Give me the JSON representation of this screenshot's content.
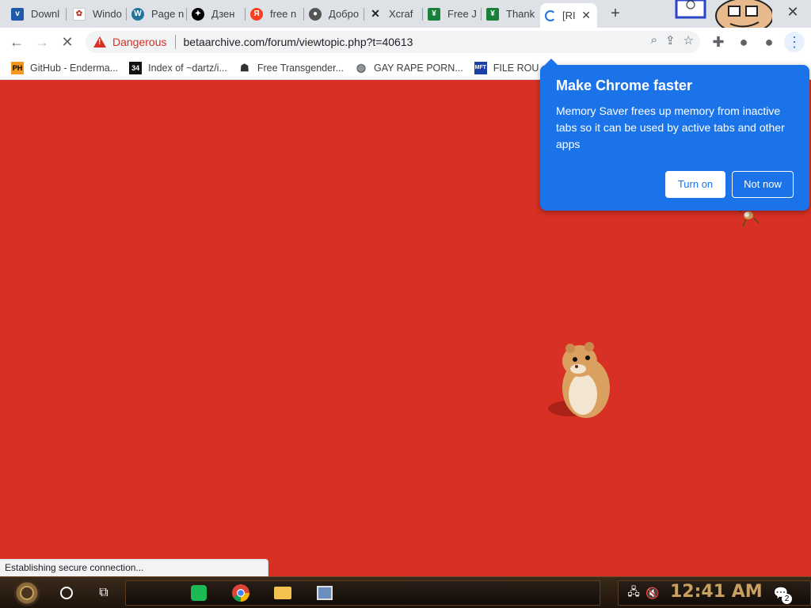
{
  "tabs": [
    {
      "label": "Downl",
      "favicon": "vimm-icon",
      "color": "#1e5aa8"
    },
    {
      "label": "Windo",
      "favicon": "windows-icon",
      "color": "#c0392b"
    },
    {
      "label": "Page n",
      "favicon": "wordpress-icon",
      "color": "#21759b"
    },
    {
      "label": "Дзен",
      "favicon": "dzen-icon",
      "color": "#000000"
    },
    {
      "label": "free n",
      "favicon": "yandex-icon",
      "color": "#fc3f1d"
    },
    {
      "label": "Добро",
      "favicon": "site-icon",
      "color": "#555555"
    },
    {
      "label": "Xcraf",
      "favicon": "xcraft-icon",
      "color": "#222222"
    },
    {
      "label": "Free J",
      "favicon": "sheet-icon",
      "color": "#188038"
    },
    {
      "label": "Thank",
      "favicon": "sheet-icon",
      "color": "#188038"
    },
    {
      "label": "[RI",
      "favicon": "loading-spinner",
      "active": true
    }
  ],
  "toolbar": {
    "security_label": "Dangerous",
    "url": "betaarchive.com/forum/viewtopic.php?t=40613"
  },
  "bookmarks": [
    {
      "label": "GitHub - Enderma...",
      "icon": "PH"
    },
    {
      "label": "Index of ~dartz/i...",
      "icon": "34"
    },
    {
      "label": "Free Transgender...",
      "icon": "mask-icon"
    },
    {
      "label": "GAY RAPE PORN...",
      "icon": "globe-icon"
    },
    {
      "label": "FILE ROU",
      "icon": "MFT"
    }
  ],
  "popup": {
    "title": "Make Chrome faster",
    "body": "Memory Saver frees up memory from inactive tabs so it can be used by active tabs and other apps",
    "primary_button": "Turn on",
    "secondary_button": "Not now"
  },
  "status_bar": "Establishing secure connection...",
  "taskbar": {
    "clock": "12:41 AM",
    "notification_count": "2"
  },
  "colors": {
    "page_background": "#d93025",
    "popup_background": "#1a73e8"
  }
}
